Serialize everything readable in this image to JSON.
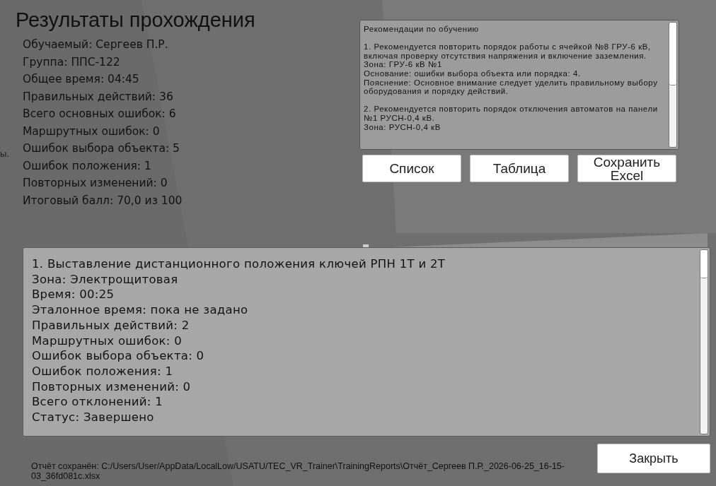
{
  "title": "Результаты прохождения",
  "stats": [
    "Обучаемый: Сергеев П.Р.",
    "Группа: ППС-122",
    "Общее время: 04:45",
    "Правильных действий: 36",
    "Всего основных ошибок: 6",
    "Маршрутных ошибок: 0",
    "Ошибок выбора объекта: 5",
    "Ошибок положения: 1",
    "Повторных изменений: 0",
    "Итоговый балл: 70,0 из 100"
  ],
  "side_fragment": "ы.",
  "recommendations": {
    "title": "Рекомендации по обучению",
    "items": [
      {
        "lines": [
          "1. Рекомендуется повторить порядок работы с ячейкой №8 ГРУ-6 кВ, включая проверку отсутствия напряжения и включение заземления.",
          "Зона: ГРУ-6 кВ №1",
          "Основание: ошибки выбора объекта или порядка: 4.",
          "Пояснение: Основное внимание следует уделить правильному выбору оборудования и порядку действий."
        ]
      },
      {
        "lines": [
          "2. Рекомендуется повторить порядок отключения автоматов на панели №1 РУСН-0,4 кВ.",
          "Зона: РУСН-0,4 кВ"
        ]
      }
    ]
  },
  "view_buttons": [
    "Список",
    "Таблица",
    "Сохранить Excel"
  ],
  "step_details": [
    "1. Выставление дистанционного положения ключей РПН 1Т и 2Т",
    "Зона: Электрощитовая",
    "Время: 00:25",
    "Эталонное время: пока не задано",
    "Правильных действий: 2",
    "Маршрутных ошибок: 0",
    "Ошибок выбора объекта: 0",
    "Ошибок положения: 1",
    "Повторных изменений: 0",
    "Всего отклонений: 1",
    "Статус: Завершено"
  ],
  "saved_path": "Отчёт сохранён: C:/Users/User/AppData/LocalLow/USATU/TEC_VR_Trainer\\TrainingReports\\Отчёт_Сергеев П.Р._2026-06-25_16-15-03_36fd081c.xlsx",
  "close_button": "Закрыть"
}
